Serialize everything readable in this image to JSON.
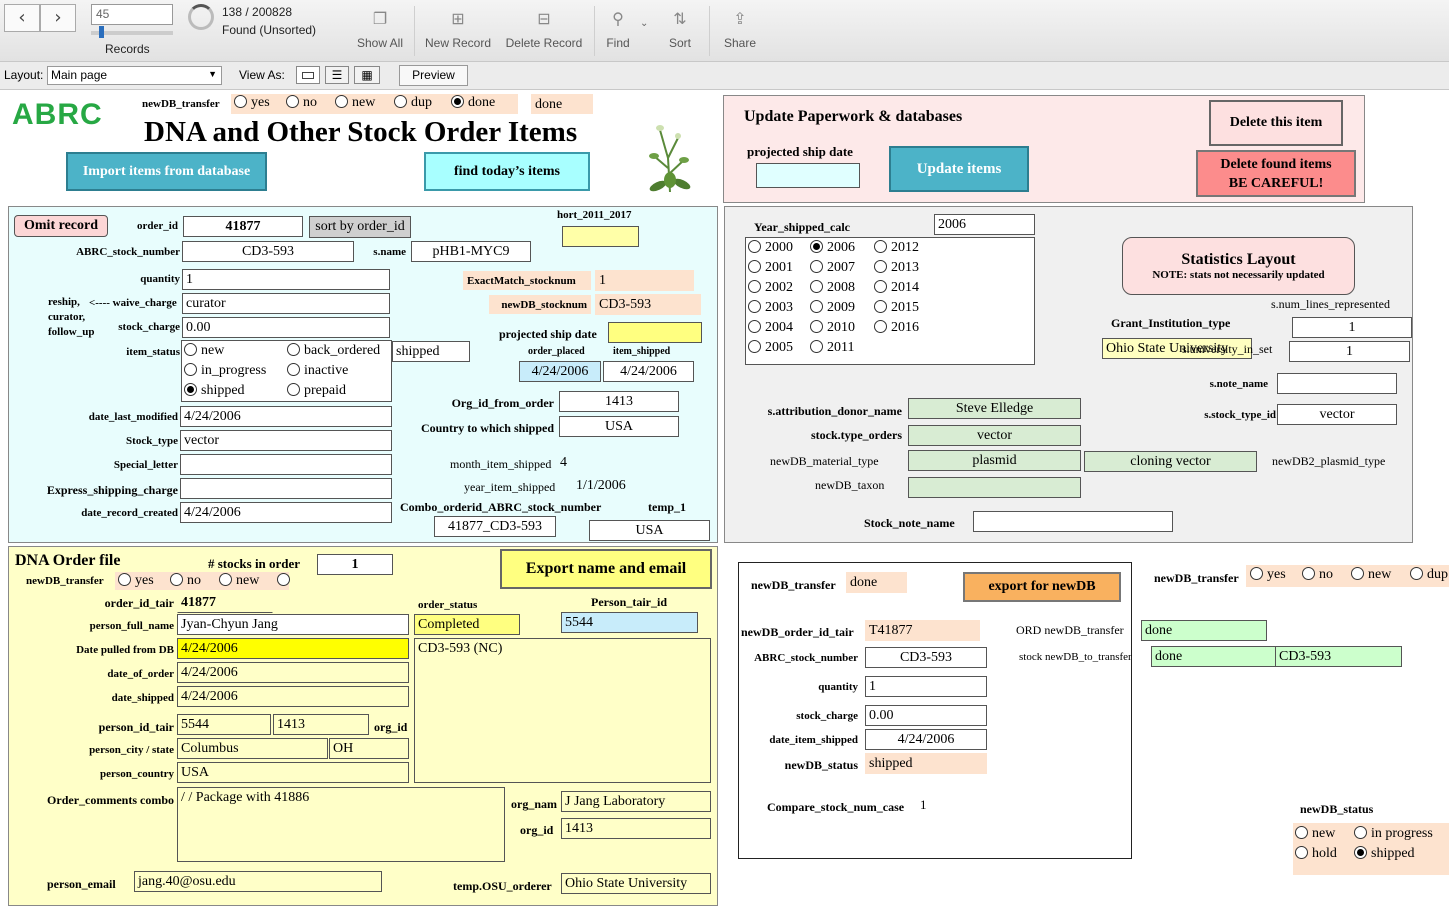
{
  "toolbar": {
    "record_number": "45",
    "records_label": "Records",
    "found_count": "138 / 200828",
    "found_status": "Found (Unsorted)",
    "show_all": "Show All",
    "new_record": "New Record",
    "delete_record": "Delete Record",
    "find": "Find",
    "sort": "Sort",
    "share": "Share",
    "record_slider_fraction": 0.12
  },
  "layoutbar": {
    "layout_label": "Layout:",
    "layout_value": "Main page",
    "view_as_label": "View As:",
    "preview": "Preview"
  },
  "header": {
    "logo": "ABRC",
    "newdb_transfer_label": "newDB_transfer",
    "transfer_options": [
      "yes",
      "no",
      "new",
      "dup",
      "done"
    ],
    "transfer_selected": "done",
    "transfer_value": "done",
    "title": "DNA and Other Stock Order Items",
    "import_button": "Import items from database",
    "find_today_button": "find today’s items"
  },
  "update_panel": {
    "title": "Update Paperwork & databases",
    "projected_ship_label": "projected ship date",
    "projected_ship_value": "",
    "update_button": "Update items",
    "delete_item_button": "Delete this item",
    "delete_found_line1": "Delete found items",
    "delete_found_line2": "BE CAREFUL!"
  },
  "order_panel": {
    "omit_button": "Omit record",
    "order_id_label": "order_id",
    "order_id": "41877",
    "sort_button": "sort by order_id",
    "hort_label": "hort_2011_2017",
    "hort_value": "",
    "abrc_stock_label": "ABRC_stock_number",
    "abrc_stock": "CD3-593",
    "sname_label": "s.name",
    "sname": "pHB1-MYC9",
    "quantity_label": "quantity",
    "quantity": "1",
    "exactmatch_label": "ExactMatch_stocknum",
    "exactmatch": "1",
    "newdb_stocknum_label": "newDB_stocknum",
    "newdb_stocknum": "CD3-593",
    "reship_label_1": "reship,",
    "reship_label_2": "curator,",
    "reship_label_3": "follow_up",
    "waive_label": "<---- waive_charge",
    "waive_value": "curator",
    "stock_charge_label": "stock_charge",
    "stock_charge": "0.00",
    "projected_ship_label": "projected ship date",
    "projected_ship_value": "",
    "item_status_label": "item_status",
    "status_options": [
      "new",
      "back_ordered",
      "in_progress",
      "inactive",
      "shipped",
      "prepaid"
    ],
    "status_selected": "shipped",
    "status_value": "shipped",
    "order_placed_label": "order_placed",
    "order_placed": "4/24/2006",
    "item_shipped_label": "item_shipped",
    "item_shipped": "4/24/2006",
    "date_last_modified_label": "date_last_modified",
    "date_last_modified": "4/24/2006",
    "org_id_from_order_label": "Org_id_from_order",
    "org_id_from_order": "1413",
    "stock_type_label": "Stock_type",
    "stock_type": "vector",
    "country_label": "Country to which shipped",
    "country": "USA",
    "special_letter_label": "Special_letter",
    "special_letter": "",
    "month_label": "month_item_shipped",
    "month_value": "4",
    "express_label": "Express_shipping_charge",
    "express_value": "",
    "year_label": "year_item_shipped",
    "year_value": "1/1/2006",
    "date_created_label": "date_record_created",
    "date_created": "4/24/2006",
    "combo_label": "Combo_orderid_ABRC_stock_number",
    "combo_value": "41877_CD3-593",
    "temp1_label": "temp_1",
    "temp1_value": "USA"
  },
  "stats_panel": {
    "year_calc_label": "Year_shipped_calc",
    "year_calc": "2006",
    "years": [
      "2000",
      "2006",
      "2012",
      "2001",
      "2007",
      "2013",
      "2002",
      "2008",
      "2014",
      "2003",
      "2009",
      "2015",
      "2004",
      "2010",
      "2016",
      "2005",
      "2011"
    ],
    "year_selected": "2006",
    "stats_button_title": "Statistics Layout",
    "stats_button_note": "NOTE: stats not necessarily updated",
    "num_lines_label": "s.num_lines_represented",
    "num_lines": "1",
    "grant_label": "Grant_Institution_type",
    "grant_value": "Ohio State University",
    "university_label": "s.university_in_set",
    "university_value": "1",
    "note_name_label": "s.note_name",
    "note_name": "",
    "donor_label": "s.attribution_donor_name",
    "donor": "Steve Elledge",
    "stock_type_id_label": "s.stock_type_id",
    "stock_type_id": "vector",
    "type_orders_label": "stock.type_orders",
    "type_orders": "vector",
    "material_label": "newDB_material_type",
    "material": "plasmid",
    "plasmid_type": "cloning vector",
    "plasmid_type_label": "newDB2_plasmid_type",
    "taxon_label": "newDB_taxon",
    "taxon": "",
    "stock_note_label": "Stock_note_name",
    "stock_note": ""
  },
  "dna_panel": {
    "title": "DNA Order file",
    "stocks_label": "# stocks in order",
    "stocks_count": "1",
    "export_button": "Export name and email",
    "transfer_label": "newDB_transfer",
    "transfer_options": [
      "yes",
      "no",
      "new",
      ""
    ],
    "order_id_tair_label": "order_id_tair",
    "order_id_tair": "41877",
    "order_status_label": "order_status",
    "order_status": "Completed",
    "person_tair_label": "Person_tair_id",
    "person_tair": "5544",
    "full_name_label": "person_full_name",
    "full_name": "Jyan-Chyun Jang",
    "date_pulled_label": "Date pulled from DB",
    "date_pulled": "4/24/2006",
    "stock_list": "CD3-593 (NC)",
    "date_of_order_label": "date_of_order",
    "date_of_order": "4/24/2006",
    "date_shipped_label": "date_shipped",
    "date_shipped": "4/24/2006",
    "person_id_label": "person_id_tair",
    "person_id": "5544",
    "org_id_mid": "1413",
    "org_id_label": "org_id",
    "city_label": "person_city / state",
    "city": "Columbus",
    "state": "OH",
    "country_label": "person_country",
    "country": "USA",
    "comments_label": "Order_comments combo",
    "comments": "/ / Package with 41886",
    "org_name_label": "org_nam",
    "org_name": "J Jang Laboratory",
    "org_id2_label": "org_id",
    "org_id2": "1413",
    "email_label": "person_email",
    "email": "jang.40@osu.edu",
    "osu_label": "temp.OSU_orderer",
    "osu_value": "Ohio State University"
  },
  "newdb_panel": {
    "transfer_label": "newDB_transfer",
    "transfer_value": "done",
    "export_button": "export for newDB",
    "order_tair_label": "newDB_order_id_tair",
    "order_tair": "T41877",
    "ord_transfer_label": "ORD newDB_transfer",
    "ord_transfer": "done",
    "abrc_label": "ABRC_stock_number",
    "abrc": "CD3-593",
    "stock_to_transfer_label": "stock newDB_to_transfer",
    "stock_to_transfer": "done",
    "stock_to_transfer_num": "CD3-593",
    "quantity_label": "quantity",
    "quantity": "1",
    "stock_charge_label": "stock_charge",
    "stock_charge": "0.00",
    "date_shipped_label": "date_item_shipped",
    "date_shipped": "4/24/2006",
    "status_label": "newDB_status",
    "status": "shipped",
    "compare_label": "Compare_stock_num_case",
    "compare_value": "1"
  },
  "right_extras": {
    "transfer_label": "newDB_transfer",
    "transfer_options": [
      "yes",
      "no",
      "new",
      "dup"
    ],
    "status_label": "newDB_status",
    "status_options": [
      "new",
      "in progress",
      "hold",
      "shipped"
    ],
    "status_selected": "shipped"
  },
  "colors": {
    "peach": "#fde3cf",
    "light_cyan": "#e0ffff",
    "light_yellow": "#ffffc8",
    "teal_button": "#4cb3c8",
    "orange_button": "#f9b15f",
    "red_button": "#fc8c8c"
  }
}
